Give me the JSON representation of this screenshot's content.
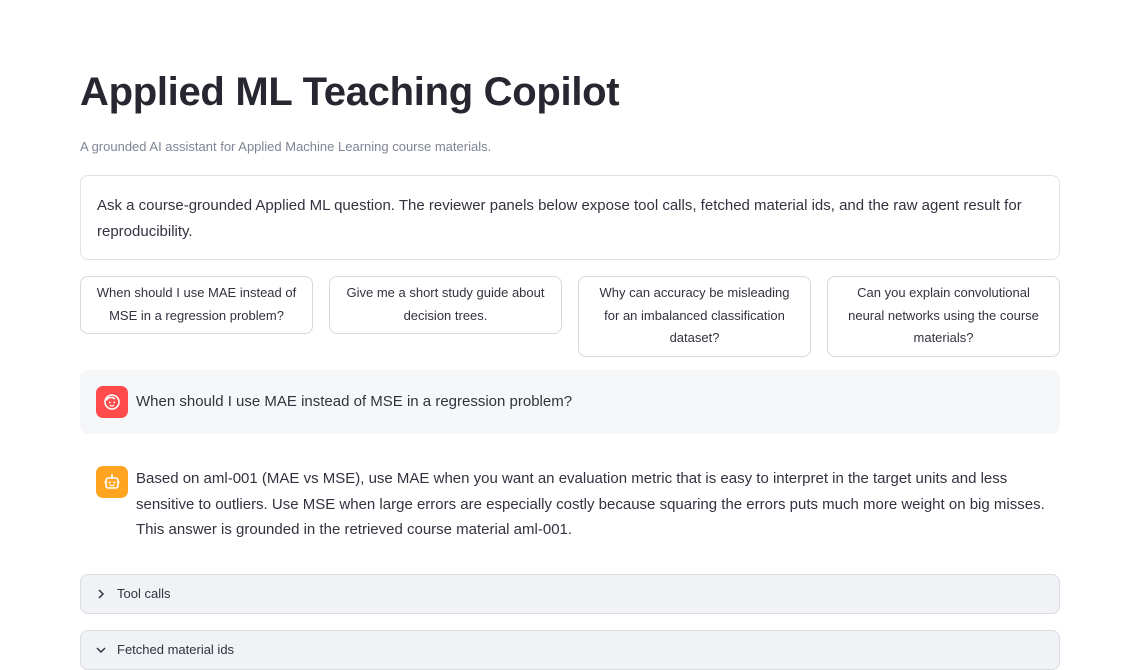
{
  "page": {
    "title": "Applied ML Teaching Copilot",
    "subtitle": "A grounded AI assistant for Applied Machine Learning course materials."
  },
  "intro": {
    "text": "Ask a course-grounded Applied ML question. The reviewer panels below expose tool calls, fetched material ids, and the raw agent result for reproducibility."
  },
  "suggestions": [
    {
      "label": "When should I use MAE instead of MSE in a regression problem?"
    },
    {
      "label": "Give me a short study guide about decision trees."
    },
    {
      "label": "Why can accuracy be misleading for an imbalanced classification dataset?"
    },
    {
      "label": "Can you explain convolutional neural networks using the course materials?"
    }
  ],
  "chat": {
    "user_message": "When should I use MAE instead of MSE in a regression problem?",
    "assistant_message": "Based on aml-001 (MAE vs MSE), use MAE when you want an evaluation metric that is easy to interpret in the target units and less sensitive to outliers. Use MSE when large errors are especially costly because squaring the errors puts much more weight on big misses. This answer is grounded in the retrieved course material aml-001.",
    "user_avatar_icon": "user-face-icon",
    "assistant_avatar_icon": "robot-icon"
  },
  "expanders": [
    {
      "label": "Tool calls",
      "icon": "chevron-right-icon"
    },
    {
      "label": "Fetched material ids",
      "icon": "chevron-down-icon"
    }
  ],
  "colors": {
    "user_avatar": "#ff4b4b",
    "assistant_avatar": "#ffa421",
    "message_bg": "#f6f7f9",
    "expander_bg": "#f0f2f6"
  }
}
